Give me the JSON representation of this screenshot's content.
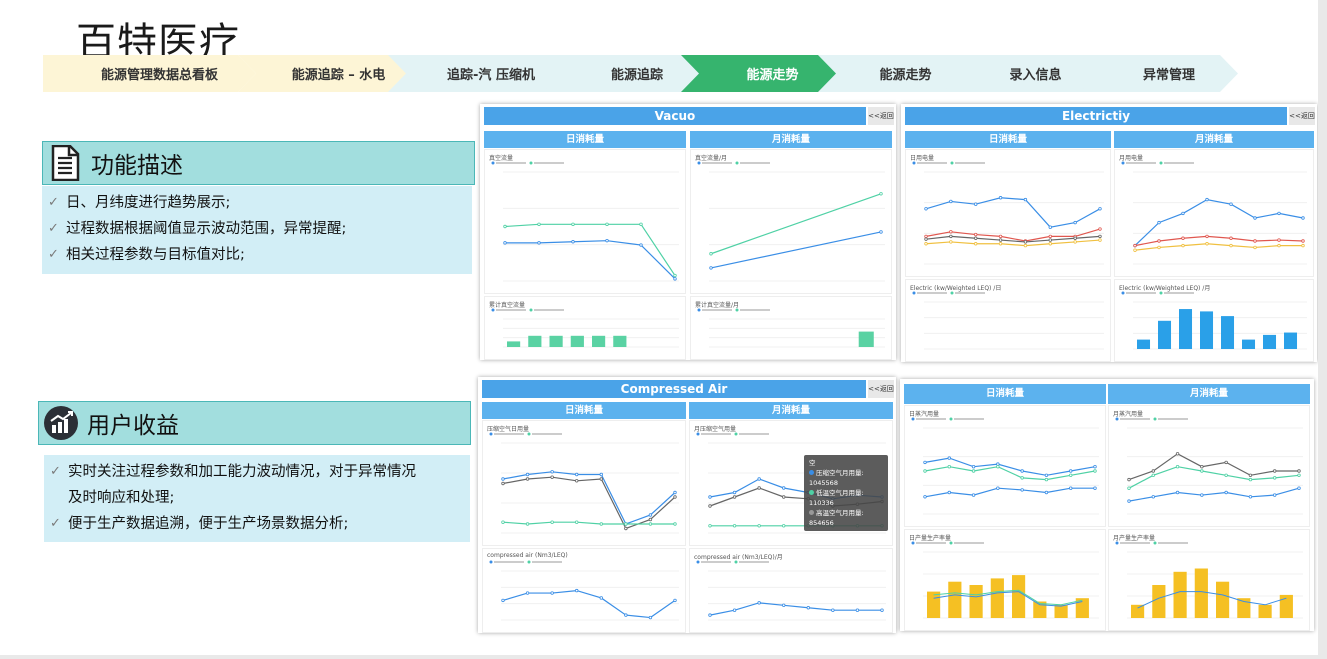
{
  "title": "百特医疗",
  "steps": [
    {
      "label": "能源管理数据总看板",
      "color": "#fdf5d6"
    },
    {
      "label": "能源追踪 – 水电",
      "color": "#fdf5d6"
    },
    {
      "label": "追踪-汽 压缩机",
      "color": "#e3f3f5"
    },
    {
      "label": "能源追踪",
      "color": "#e3f3f5"
    },
    {
      "label": "能源走势",
      "color": "#36b46e",
      "active": true
    },
    {
      "label": "能源走势",
      "color": "#e3f3f5"
    },
    {
      "label": "录入信息",
      "color": "#e3f3f5"
    },
    {
      "label": "异常管理",
      "color": "#e3f3f5"
    }
  ],
  "function_desc": {
    "heading": "功能描述",
    "items": [
      "日、月纬度进行趋势展示;",
      "过程数据根据阈值显示波动范围，异常提醒;",
      "相关过程参数与目标值对比;"
    ]
  },
  "user_benefit": {
    "heading": "用户收益",
    "items": [
      "实时关注过程参数和加工能力波动情况，对于异常情况",
      "及时响应和处理;",
      "便于生产数据追溯，便于生产场景数据分析;"
    ]
  },
  "panels": {
    "vacuo": {
      "title": "Vacuo",
      "back": "<<返回",
      "day": "日消耗量",
      "month": "月消耗量",
      "c1": "真空流量",
      "c2": "真空流量/月",
      "c3": "累计真空流量",
      "c4": "累计真空流量/月"
    },
    "elec": {
      "title": "Electrictiy",
      "back": "<<返回",
      "day": "日消耗量",
      "month": "月消耗量",
      "c1": "日用电量",
      "c2": "月用电量",
      "c3": "Electric (kw/Weighted LEQ) /日",
      "c4": "Electric (kw/Weighted LEQ) /月"
    },
    "air": {
      "title": "Compressed Air",
      "back": "<<返回",
      "day": "日消耗量",
      "month": "月消耗量",
      "c1": "压缩空气日用量",
      "c2": "月压缩空气用量",
      "c3": "compressed air (Nm3/LEQ)",
      "c4": "compressed air (Nm3/LEQ)/月",
      "tooltip": {
        "head": "空",
        "rows": [
          "压缩空气月用量: 1045568",
          "低温空气月用量: 110336",
          "高温空气月用量: 854656"
        ],
        "colors": [
          "#3a8ee6",
          "#4fd1a5",
          "#999999"
        ]
      }
    },
    "steam": {
      "day": "日消耗量",
      "month": "月消耗量",
      "c1": "日蒸汽用量",
      "c2": "月蒸汽用量",
      "c3": "日产量生产率量",
      "c4": "月产量生产率量"
    }
  }
}
